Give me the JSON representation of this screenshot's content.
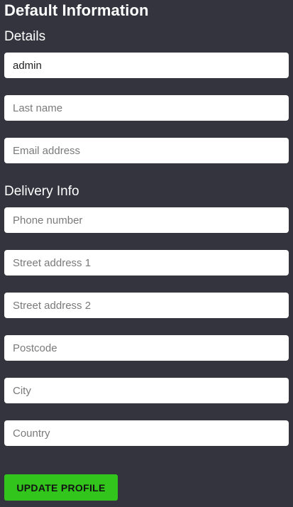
{
  "page": {
    "title": "Default Information"
  },
  "details": {
    "heading": "Details",
    "first_name": {
      "value": "admin",
      "placeholder": ""
    },
    "last_name": {
      "value": "",
      "placeholder": "Last name"
    },
    "email": {
      "value": "",
      "placeholder": "Email address"
    }
  },
  "delivery": {
    "heading": "Delivery Info",
    "phone": {
      "value": "",
      "placeholder": "Phone number"
    },
    "street1": {
      "value": "",
      "placeholder": "Street address 1"
    },
    "street2": {
      "value": "",
      "placeholder": "Street address 2"
    },
    "postcode": {
      "value": "",
      "placeholder": "Postcode"
    },
    "city": {
      "value": "",
      "placeholder": "City"
    },
    "country": {
      "value": "",
      "placeholder": "Country"
    }
  },
  "actions": {
    "update_label": "UPDATE PROFILE"
  },
  "colors": {
    "background": "#33343e",
    "button": "#32c51b"
  }
}
